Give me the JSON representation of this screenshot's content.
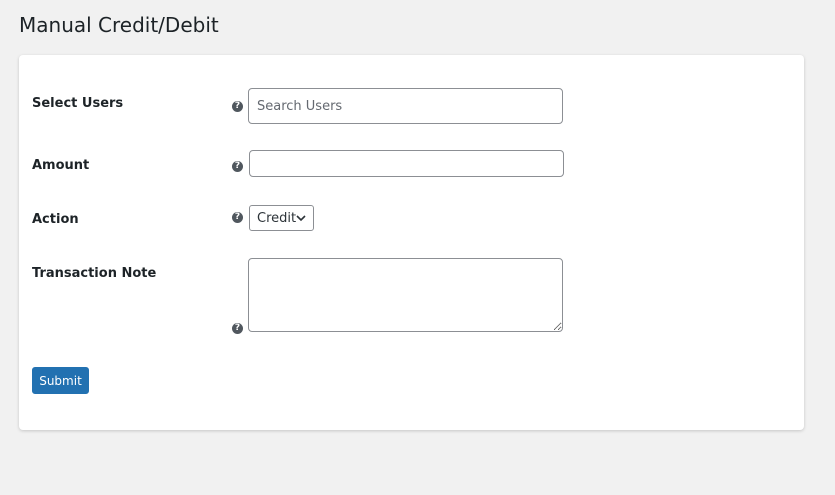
{
  "page": {
    "title": "Manual Credit/Debit"
  },
  "form": {
    "select_users": {
      "label": "Select Users",
      "placeholder": "Search Users",
      "value": ""
    },
    "amount": {
      "label": "Amount",
      "value": ""
    },
    "action": {
      "label": "Action",
      "selected": "Credit"
    },
    "transaction_note": {
      "label": "Transaction Note",
      "value": ""
    },
    "submit_label": "Submit",
    "help_icon": "question-circle-icon"
  },
  "colors": {
    "accent": "#2271b1",
    "background": "#f1f1f1",
    "card": "#ffffff",
    "help_icon": "#50575e"
  }
}
